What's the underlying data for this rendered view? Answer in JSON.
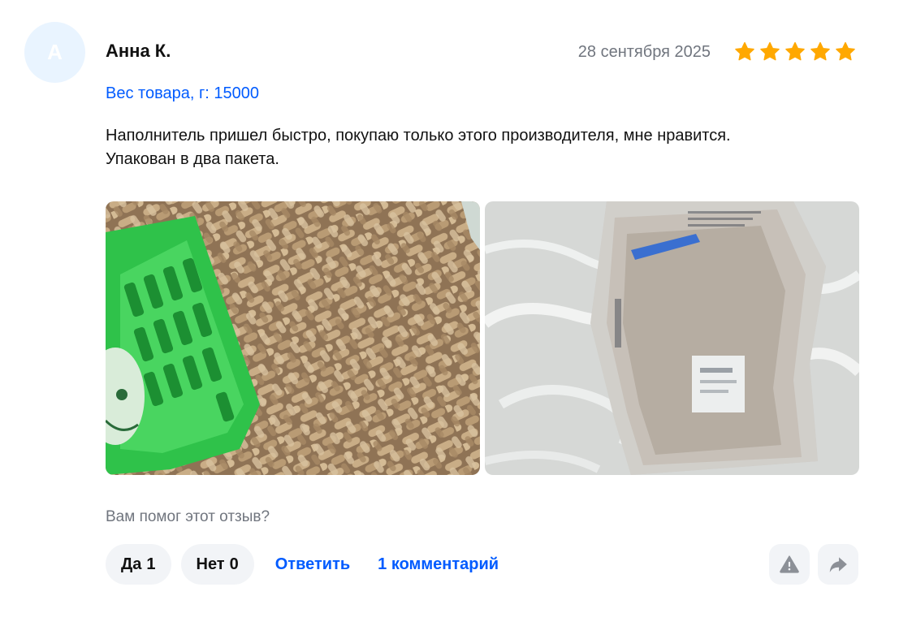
{
  "review": {
    "avatar_letter": "А",
    "author": "Анна К.",
    "date": "28 сентября 2025",
    "rating": 5,
    "rating_max": 5,
    "star_color": "#ffa800",
    "variant": "Вес товара, г: 15000",
    "text_lines": [
      "Наполнитель пришел быстро, покупаю только этого производителя, мне нравится.",
      "Упакован в два пакета."
    ]
  },
  "photos": [
    {
      "subject": "wood-pellets-with-green-scoop"
    },
    {
      "subject": "packed-bag-on-marble-floor"
    }
  ],
  "feedback": {
    "question": "Вам помог этот отзыв?",
    "yes_label": "Да",
    "yes_count": "1",
    "no_label": "Нет",
    "no_count": "0",
    "reply_label": "Ответить",
    "comments_label": "1 комментарий"
  },
  "icons": {
    "report": "warning-icon",
    "share": "share-icon"
  },
  "colors": {
    "link": "#005bff",
    "muted": "#70757e",
    "button_bg": "#f2f4f7",
    "avatar_bg": "#e9f4ff"
  }
}
